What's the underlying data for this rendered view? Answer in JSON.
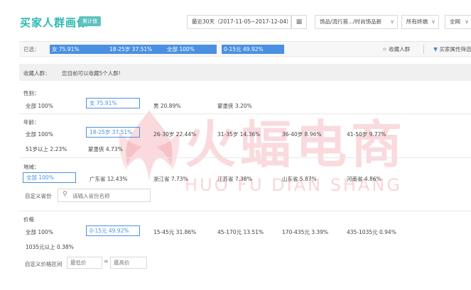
{
  "header": {
    "title": "买家人群画像",
    "badge": "累计值",
    "date_range": "最近30天（2017-11-05~2017-12-04）",
    "category": "饰品/流行首.../时尚饰品新",
    "terminal": "所有终端",
    "scope": "全网"
  },
  "selected": {
    "label": "已选：",
    "chips": [
      "女 75.91%",
      "18-25岁 37.51%",
      "全部 100%",
      "0-15元 49.92%"
    ],
    "favorite_label": "收藏人群",
    "filter_label": "买家属性筛选"
  },
  "favorites": {
    "label": "收藏人群：",
    "hint": "您目前可以收藏5个人群!"
  },
  "gender": {
    "title": "性别：",
    "options": [
      "全部  100%",
      "女  75.91%",
      "男  20.89%",
      "蒙墨侠  3.20%"
    ]
  },
  "age": {
    "title": "年龄：",
    "options": [
      "全部  100%",
      "18-25岁  37.51%",
      "26-30岁  22.44%",
      "31-35岁  14.36%",
      "36-40岁  8.96%",
      "41-50岁  9.77%",
      "51岁以上  2.23%",
      "蒙墨侠  4.73%"
    ]
  },
  "region": {
    "title": "地域：",
    "options": [
      "全部  100%",
      "广东省  12.43%",
      "浙江省  7.73%",
      "江苏省  7.38%",
      "山东省  5.87%",
      "河南省  4.86%"
    ],
    "custom_label": "自定义省份",
    "search_placeholder": "请输入省份名称"
  },
  "price": {
    "title": "价格",
    "options": [
      "全部  100%",
      "0-15元  49.92%",
      "15-45元  31.86%",
      "45-170元  13.51%",
      "170-435元  3.39%",
      "435-1035元  0.94%",
      "1035元以上  0.38%"
    ],
    "custom_label": "自定义价格区间",
    "min_placeholder": "最低价",
    "max_placeholder": "最高价",
    "separator": "="
  },
  "watermark": {
    "cn": "火蝠电商",
    "en": "HUO FU DIAN SHANG"
  },
  "colors": {
    "brand_teal": "#2fb8b0",
    "accent_blue": "#4a90e2",
    "watermark_red": "#e85666"
  }
}
